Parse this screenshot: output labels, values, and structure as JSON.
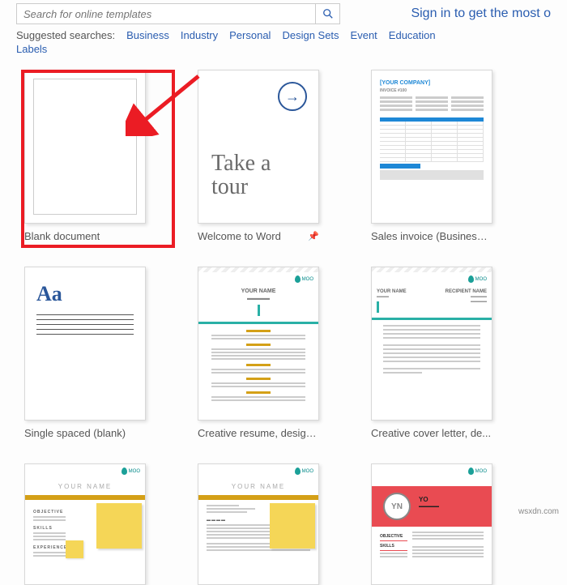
{
  "search": {
    "placeholder": "Search for online templates"
  },
  "header": {
    "sign_in": "Sign in to get the most o"
  },
  "suggest": {
    "label": "Suggested searches:",
    "items": [
      "Business",
      "Industry",
      "Personal",
      "Design Sets",
      "Event",
      "Education",
      "Labels"
    ]
  },
  "templates": {
    "t0": {
      "title": "Blank document"
    },
    "t1": {
      "title": "Welcome to Word",
      "tour_line1": "Take a",
      "tour_line2": "tour"
    },
    "t2": {
      "title": "Sales invoice (Business ...",
      "company": "[YOUR COMPANY]",
      "sub": "INVOICE #100"
    },
    "t3": {
      "title": "Single spaced (blank)",
      "aa": "Aa"
    },
    "t4": {
      "title": "Creative resume, design...",
      "name": "YOUR NAME",
      "moo": "MOO"
    },
    "t5": {
      "title": "Creative cover letter, de...",
      "name": "YOUR NAME",
      "recipient": "RECIPIENT NAME",
      "moo": "MOO"
    },
    "t6": {
      "name": "YOUR NAME",
      "moo": "MOO"
    },
    "t7": {
      "name": "YOUR NAME",
      "moo": "MOO"
    },
    "t8": {
      "yn": "YN",
      "yo": "YO",
      "moo": "MOO",
      "obj": "OBJECTIVE",
      "skills": "SKILLS"
    }
  },
  "watermark": "wsxdn.com"
}
